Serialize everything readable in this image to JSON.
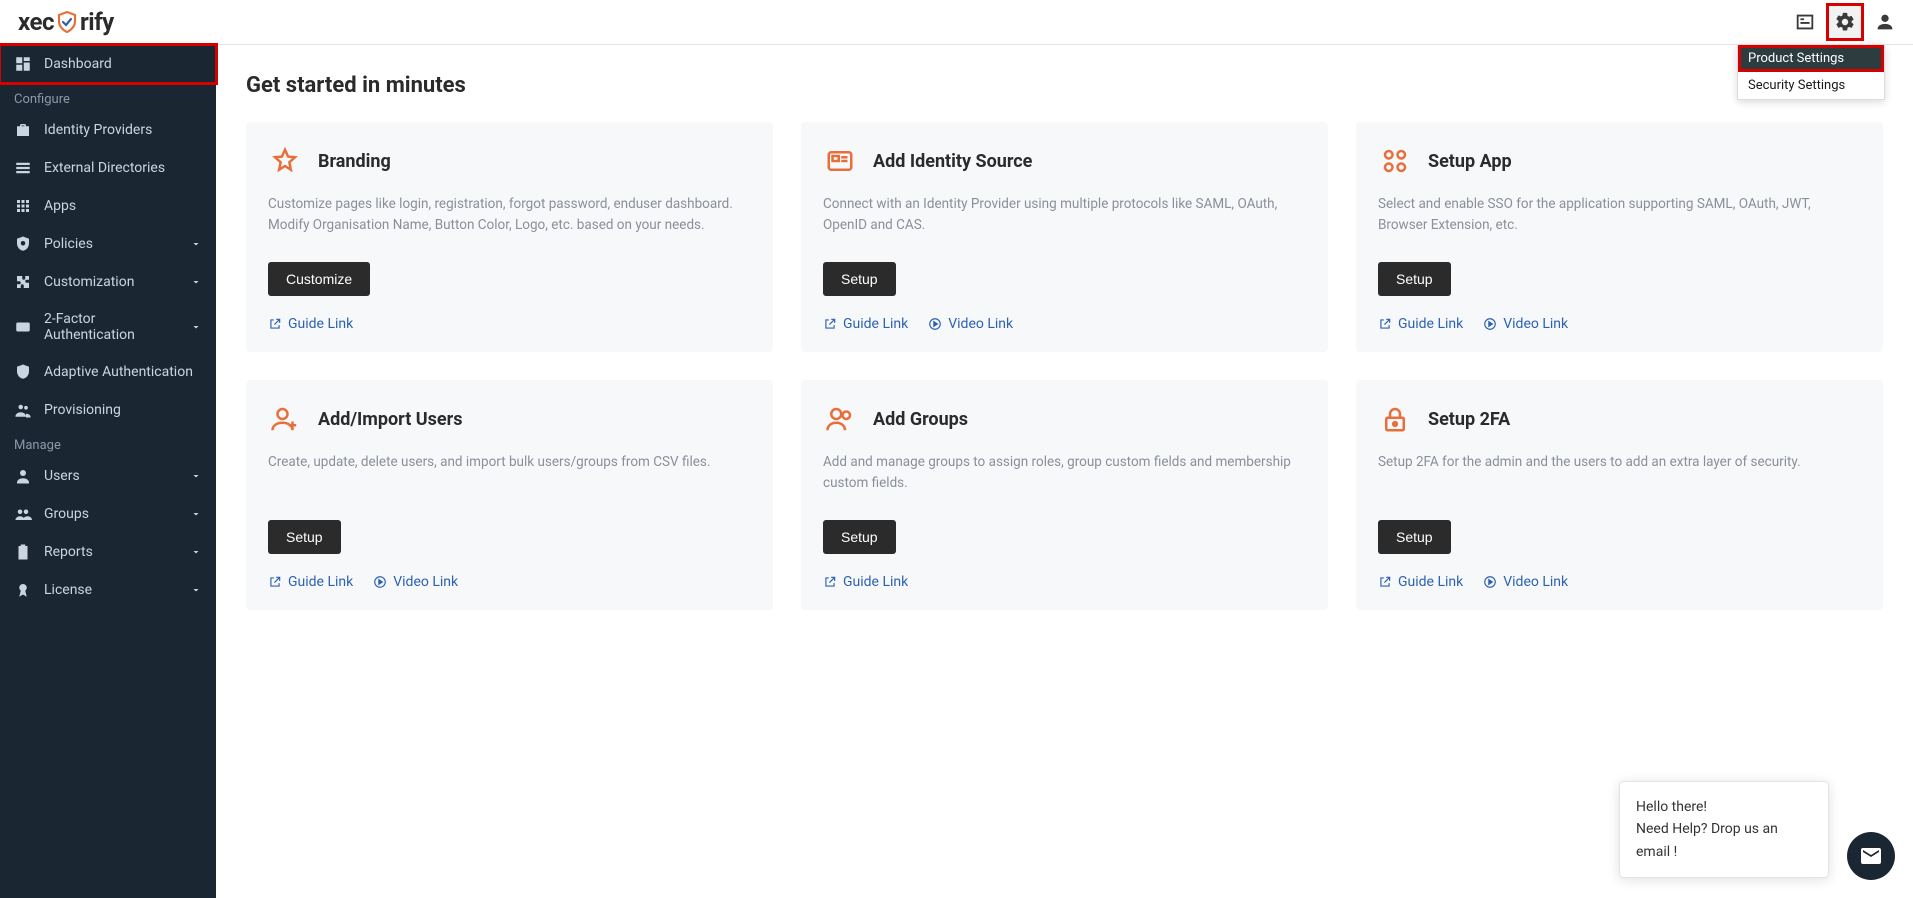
{
  "brand": {
    "name_left": "xec",
    "name_right": "rify"
  },
  "header_menu": {
    "items": [
      {
        "label": "Product Settings"
      },
      {
        "label": "Security Settings"
      }
    ]
  },
  "sidebar": {
    "items_top": [
      {
        "label": "Dashboard",
        "icon": "dashboard",
        "active": true
      }
    ],
    "section_configure": "Configure",
    "items_configure": [
      {
        "label": "Identity Providers",
        "icon": "briefcase"
      },
      {
        "label": "External Directories",
        "icon": "list"
      },
      {
        "label": "Apps",
        "icon": "grid"
      },
      {
        "label": "Policies",
        "icon": "shield-search",
        "expandable": true
      },
      {
        "label": "Customization",
        "icon": "puzzle",
        "expandable": true
      },
      {
        "label": "2-Factor Authentication",
        "icon": "twofa",
        "expandable": true
      },
      {
        "label": "Adaptive Authentication",
        "icon": "shield-check"
      },
      {
        "label": "Provisioning",
        "icon": "people"
      }
    ],
    "section_manage": "Manage",
    "items_manage": [
      {
        "label": "Users",
        "icon": "user",
        "expandable": true
      },
      {
        "label": "Groups",
        "icon": "groups",
        "expandable": true
      },
      {
        "label": "Reports",
        "icon": "clipboard",
        "expandable": true
      },
      {
        "label": "License",
        "icon": "badge",
        "expandable": true
      }
    ]
  },
  "page": {
    "title": "Get started in minutes",
    "link_guide": "Guide Link",
    "link_video": "Video Link"
  },
  "cards": [
    {
      "title": "Branding",
      "desc": "Customize pages like login, registration, forgot password, enduser dashboard. Modify Organisation Name, Button Color, Logo, etc. based on your needs.",
      "action": "Customize",
      "guide": true,
      "video": false,
      "icon": "star"
    },
    {
      "title": "Add Identity Source",
      "desc": "Connect with an Identity Provider using multiple protocols like SAML, OAuth, OpenID and CAS.",
      "action": "Setup",
      "guide": true,
      "video": true,
      "icon": "idcard"
    },
    {
      "title": "Setup App",
      "desc": "Select and enable SSO for the application supporting SAML, OAuth, JWT, Browser Extension, etc.",
      "action": "Setup",
      "guide": true,
      "video": true,
      "icon": "apps"
    },
    {
      "title": "Add/Import Users",
      "desc": "Create, update, delete users, and import bulk users/groups from CSV files.",
      "action": "Setup",
      "guide": true,
      "video": true,
      "icon": "userplus"
    },
    {
      "title": "Add Groups",
      "desc": "Add and manage groups to assign roles, group custom fields and membership custom fields.",
      "action": "Setup",
      "guide": true,
      "video": false,
      "icon": "users"
    },
    {
      "title": "Setup 2FA",
      "desc": "Setup 2FA for the admin and the users to add an extra layer of security.",
      "action": "Setup",
      "guide": true,
      "video": true,
      "icon": "lock"
    }
  ],
  "chat": {
    "line1": "Hello there!",
    "line2": "Need Help? Drop us an email !"
  }
}
